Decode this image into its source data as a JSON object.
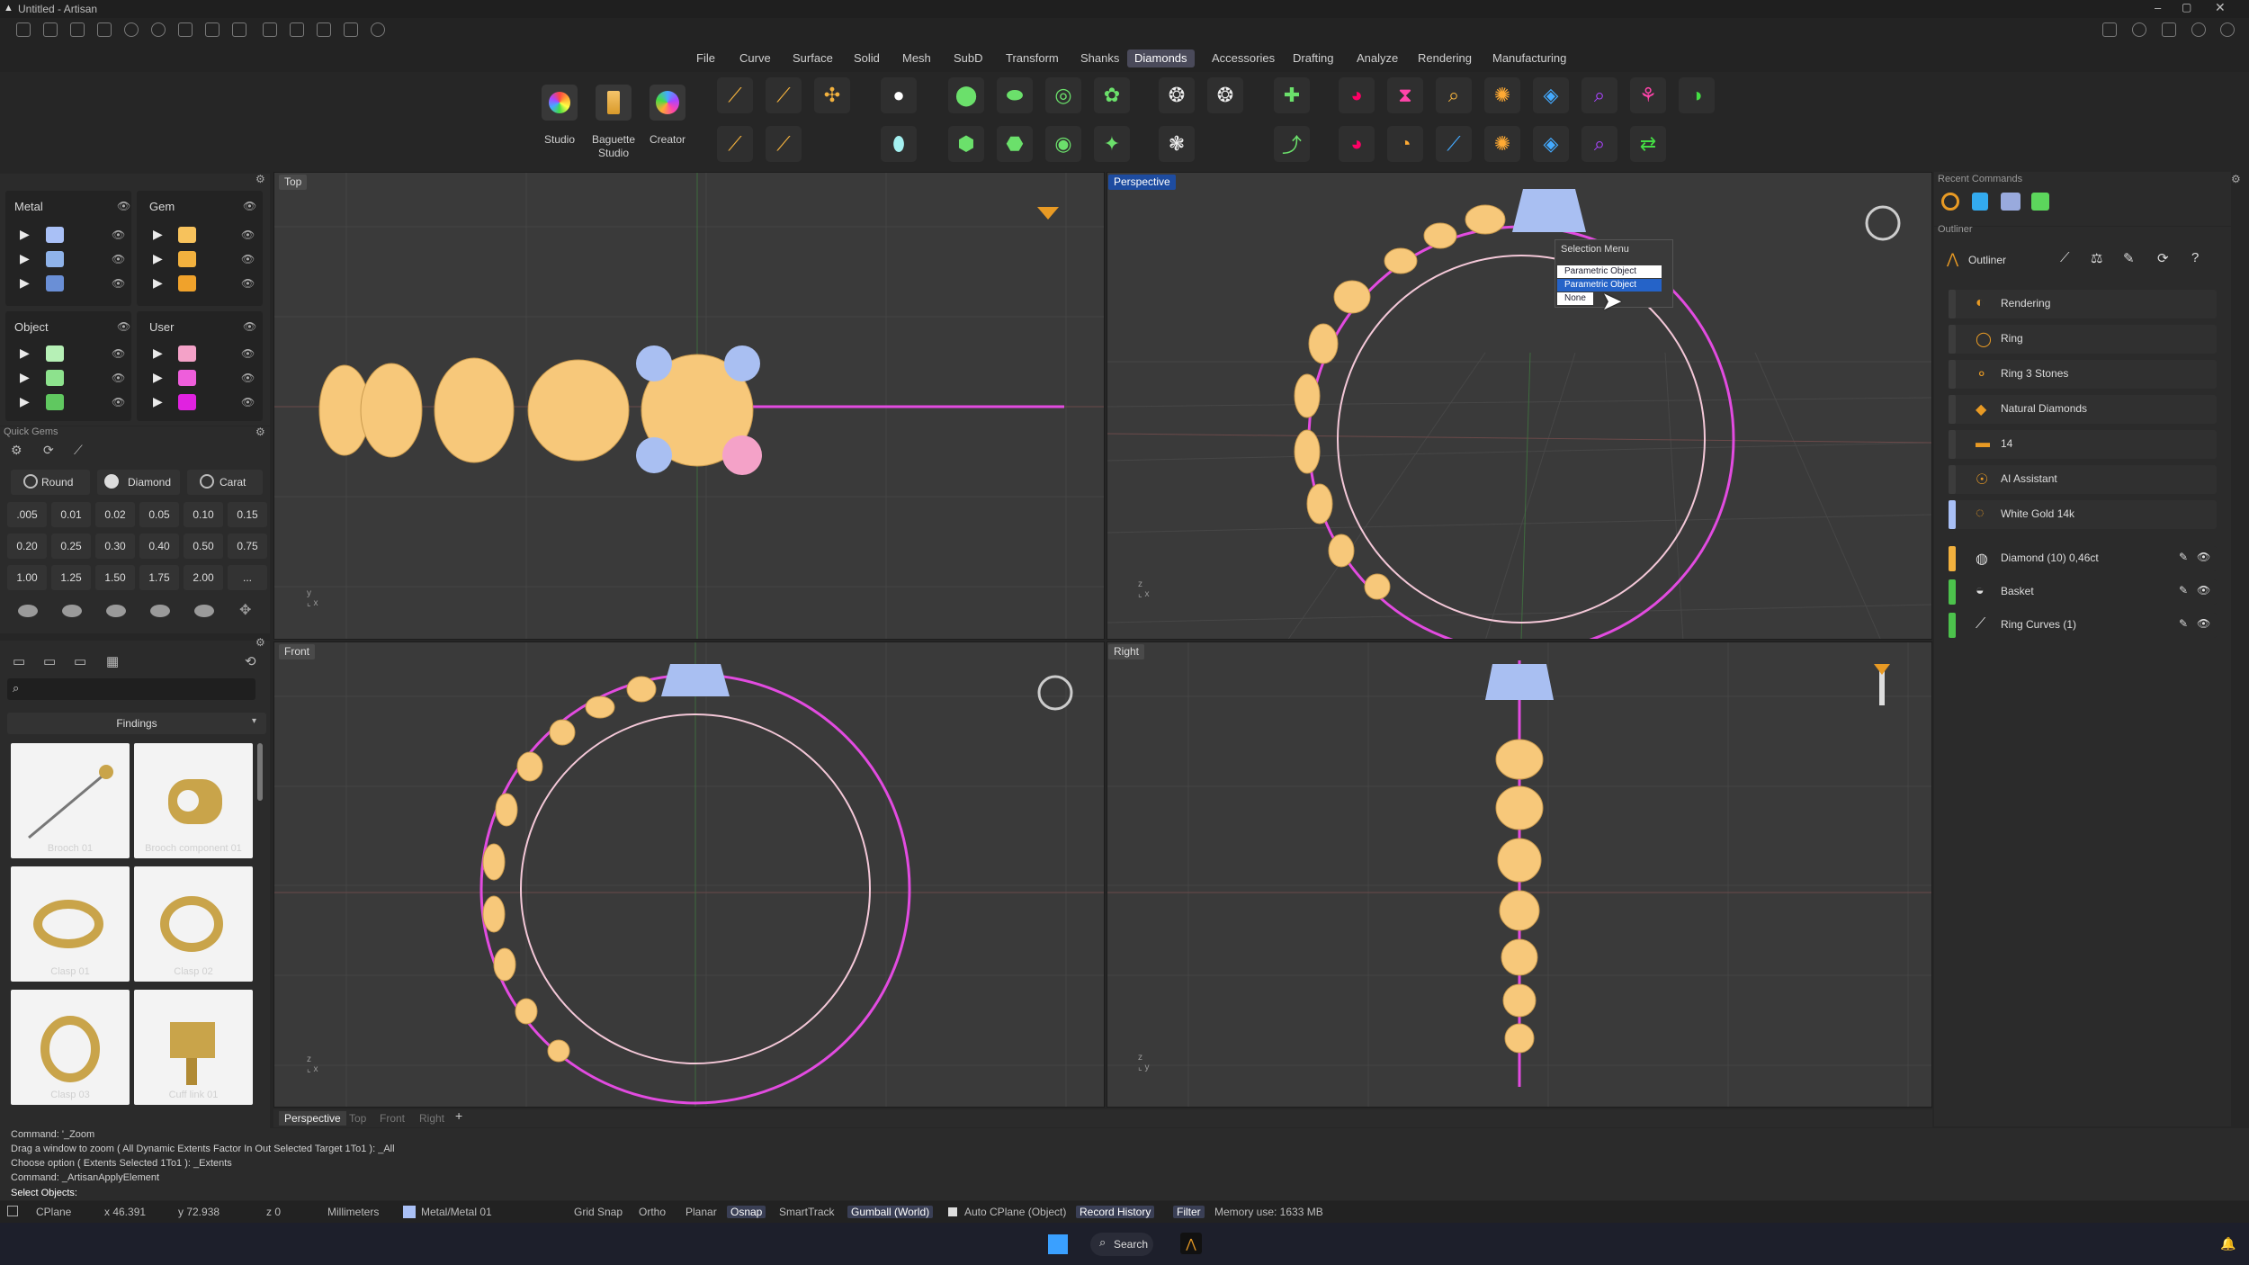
{
  "window": {
    "title": "Untitled - Artisan"
  },
  "menus": [
    "File",
    "Curve",
    "Surface",
    "Solid",
    "Mesh",
    "SubD",
    "Transform",
    "Shanks",
    "Diamonds",
    "Accessories",
    "Drafting",
    "Analyze",
    "Rendering",
    "Manufacturing"
  ],
  "active_menu": "Diamonds",
  "ribbon": {
    "studio": "Studio",
    "baguette_line1": "Baguette",
    "baguette_line2": "Studio",
    "creator": "Creator"
  },
  "layers": {
    "metal": "Metal",
    "gem": "Gem",
    "object": "Object",
    "user": "User",
    "metal_colors": [
      "#a9c0f6",
      "#8fb3ea",
      "#6a8fd6"
    ],
    "gem_colors": [
      "#f7c25c",
      "#f2b13e",
      "#f0a22b"
    ],
    "object_colors": [
      "#b6f0b6",
      "#8de28d",
      "#60c860"
    ],
    "user_colors": [
      "#f4a2c8",
      "#ee5edb",
      "#e022e0"
    ]
  },
  "quick_gems": {
    "title": "Quick Gems",
    "shape": "Round",
    "material": "Diamond",
    "unit": "Carat",
    "sizes": [
      ".005",
      "0.01",
      "0.02",
      "0.05",
      "0.10",
      "0.15",
      "0.20",
      "0.25",
      "0.30",
      "0.40",
      "0.50",
      "0.75",
      "1.00",
      "1.25",
      "1.50",
      "1.75",
      "2.00",
      "..."
    ]
  },
  "library": {
    "category": "Findings",
    "items": [
      "Brooch 01",
      "Brooch component 01",
      "Clasp 01",
      "Clasp 02",
      "Clasp 03",
      "Cuff link 01"
    ]
  },
  "viewports": {
    "top": "Top",
    "perspective": "Perspective",
    "front": "Front",
    "right": "Right",
    "tabs": [
      "Perspective",
      "Top",
      "Front",
      "Right"
    ]
  },
  "selection_menu": {
    "title": "Selection Menu",
    "items": [
      "Parametric Object",
      "Parametric Object",
      "None"
    ],
    "highlighted": 1
  },
  "recent_commands": {
    "title": "Recent Commands"
  },
  "outliner": {
    "section": "Outliner",
    "title": "Outliner",
    "items": [
      {
        "label": "Rendering",
        "bar": "#3c3c3c"
      },
      {
        "label": "Ring",
        "bar": "#3c3c3c"
      },
      {
        "label": "Ring 3 Stones",
        "bar": "#3c3c3c"
      },
      {
        "label": "Natural Diamonds",
        "bar": "#3c3c3c"
      },
      {
        "label": "14",
        "bar": "#3c3c3c"
      },
      {
        "label": "AI Assistant",
        "bar": "#3c3c3c"
      },
      {
        "label": "White Gold 14k",
        "bar": "#a9c0f6"
      }
    ],
    "objects": [
      {
        "label": "Diamond (10) 0,46ct",
        "bar": "#f2b13e"
      },
      {
        "label": "Basket",
        "bar": "#4cc24c"
      },
      {
        "label": "Ring Curves (1)",
        "bar": "#4cc24c"
      }
    ]
  },
  "command_history": [
    "Command: '_Zoom",
    "Drag a window to zoom ( All  Dynamic  Extents  Factor  In  Out  Selected  Target  1To1 ): _All",
    "Choose option ( Extents  Selected  1To1 ): _Extents",
    "Command: _ArtisanApplyElement"
  ],
  "command_prompt": "Select Objects:",
  "status": {
    "cplane": "CPlane",
    "x": "x 46.391",
    "y": "y 72.938",
    "z": "z 0",
    "units": "Millimeters",
    "layer": "Metal/Metal 01",
    "grid_snap": "Grid Snap",
    "ortho": "Ortho",
    "planar": "Planar",
    "osnap": "Osnap",
    "smarttrack": "SmartTrack",
    "gumball": "Gumball (World)",
    "auto_cplane": "Auto CPlane (Object)",
    "record_history": "Record History",
    "filter": "Filter",
    "memory": "Memory use: 1633 MB"
  },
  "taskbar": {
    "search": "Search"
  },
  "colors": {
    "accent": "#1e4ca0",
    "metal": "#f7c87a",
    "curve": "#e24be0",
    "selected_prong": "#a9bff2"
  }
}
